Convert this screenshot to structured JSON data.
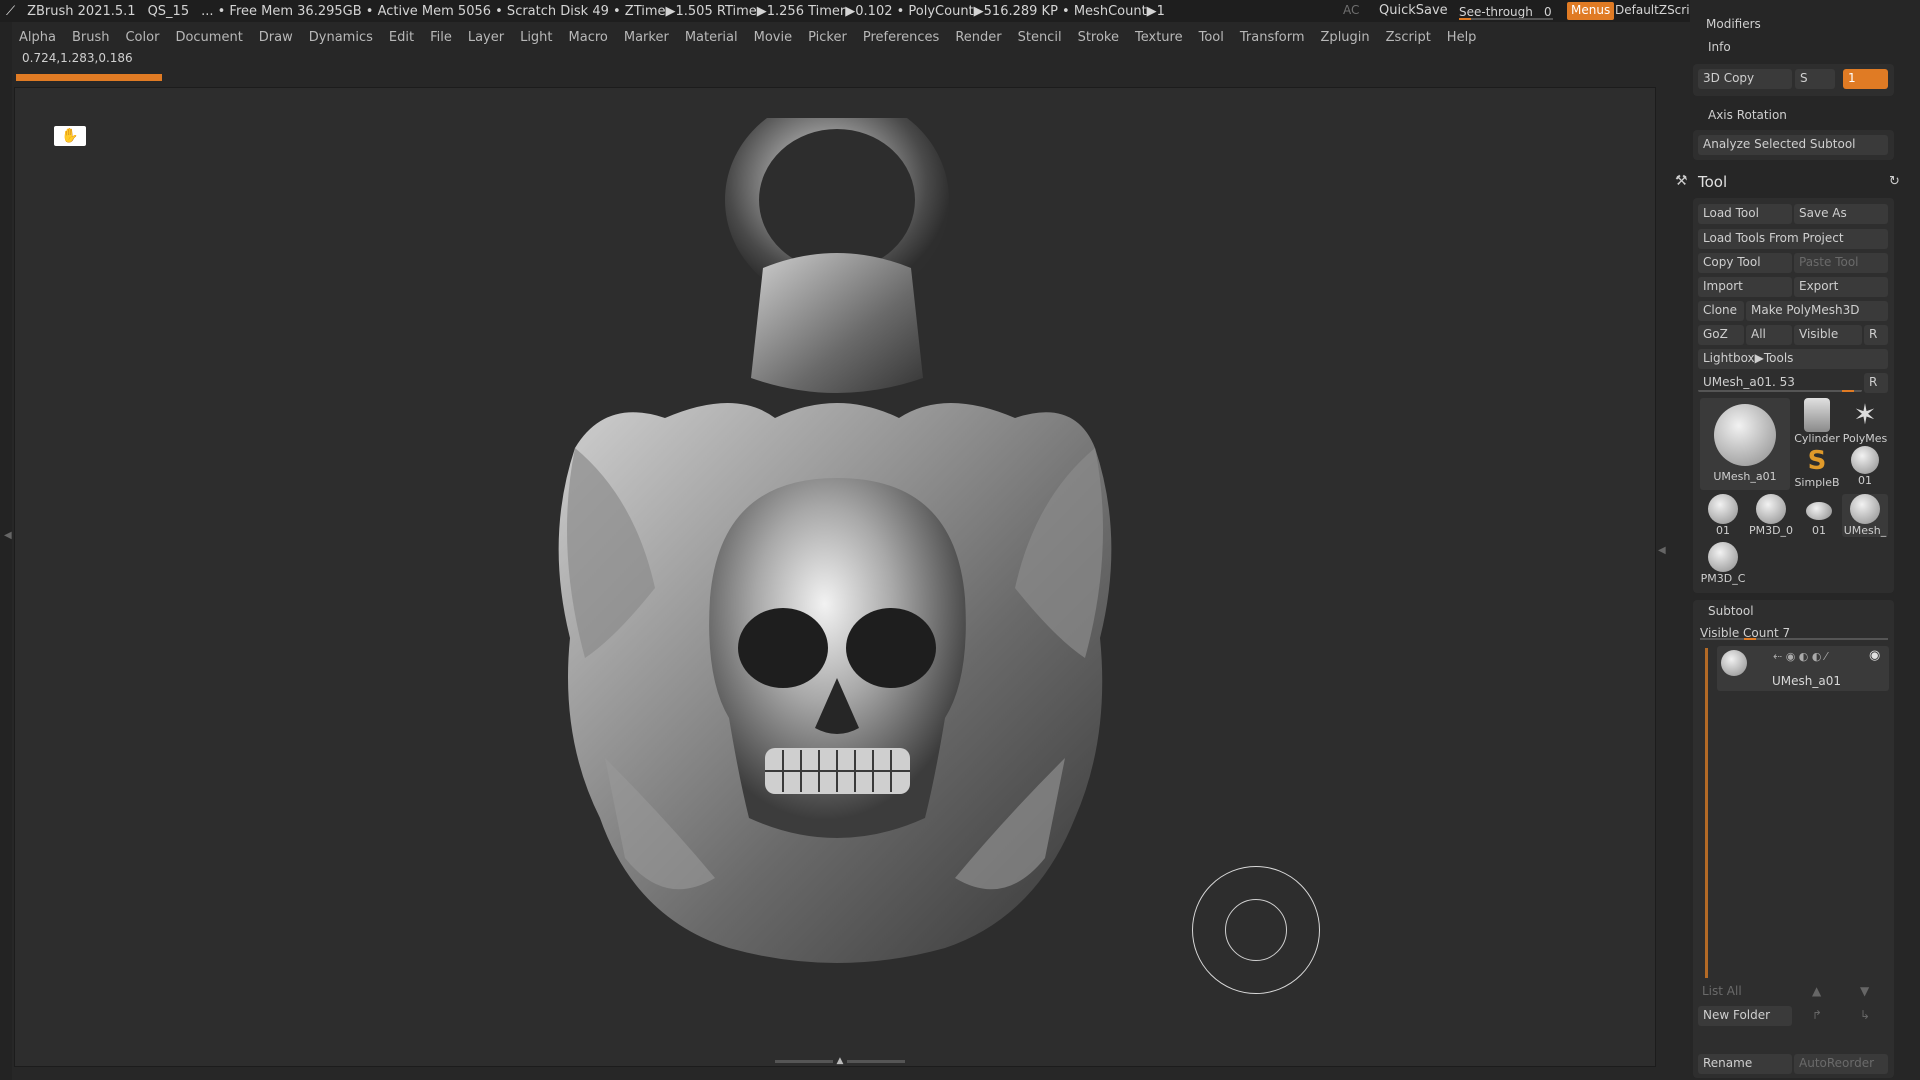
{
  "titlebar": {
    "app": "ZBrush 2021.5.1",
    "doc": "QS_15",
    "stats": "... • Free Mem 36.295GB • Active Mem 5056 • Scratch Disk 49 • ZTime▶1.505 RTime▶1.256 Timer▶0.102 • PolyCount▶516.289 KP • MeshCount▶1",
    "ac": "AC",
    "quicksave": "QuickSave",
    "seethrough_label": "See-through",
    "seethrough_value": "0",
    "menus": "Menus",
    "script": "DefaultZScript"
  },
  "menubar": [
    "Alpha",
    "Brush",
    "Color",
    "Document",
    "Draw",
    "Dynamics",
    "Edit",
    "File",
    "Layer",
    "Light",
    "Macro",
    "Marker",
    "Material",
    "Movie",
    "Picker",
    "Preferences",
    "Render",
    "Stencil",
    "Stroke",
    "Texture",
    "Tool",
    "Transform",
    "Zplugin",
    "Zscript",
    "Help"
  ],
  "coords": "0.724,1.283,0.186",
  "right_panel": {
    "modifiers": "Modifiers",
    "info": "Info",
    "copy3d": "3D Copy",
    "s_label": "S",
    "s_value": "1",
    "axis_rotation": "Axis Rotation",
    "analyze": "Analyze Selected Subtool",
    "tool_title": "Tool",
    "load_tool": "Load Tool",
    "save_as": "Save As",
    "load_tools_project": "Load Tools From Project",
    "copy_tool": "Copy Tool",
    "paste_tool": "Paste Tool",
    "import": "Import",
    "export": "Export",
    "clone": "Clone",
    "make_polymesh": "Make PolyMesh3D",
    "goz": "GoZ",
    "all": "All",
    "visible": "Visible",
    "r": "R",
    "lightbox_tools": "Lightbox▶Tools",
    "current_tool": "UMesh_a01. 53",
    "thumbs": [
      "UMesh_a01",
      "Cylinder",
      "PolyMes",
      "SimpleB",
      "01",
      "01",
      "PM3D_0",
      "01",
      "UMesh_",
      "PM3D_C"
    ],
    "subtool": "Subtool",
    "visible_count": "Visible Count 7",
    "subtool_item": "UMesh_a01",
    "list_all": "List All",
    "new_folder": "New Folder",
    "rename": "Rename",
    "autoreorder": "AutoReorder"
  },
  "colors": {
    "accent": "#e07b24",
    "bg": "#272727",
    "panel": "#2e2e2e"
  }
}
